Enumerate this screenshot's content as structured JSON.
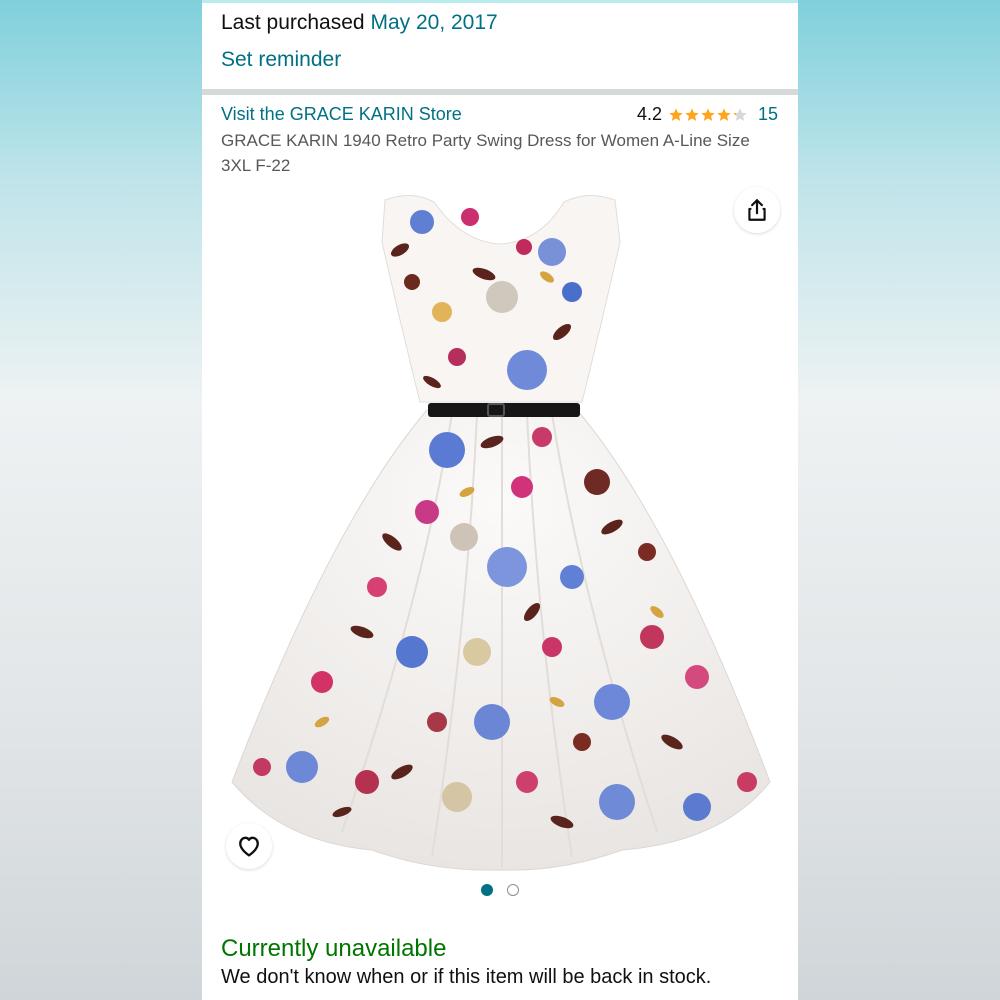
{
  "purchase": {
    "label": "Last purchased",
    "date": "May 20, 2017",
    "reminder_label": "Set reminder"
  },
  "product": {
    "store_link": "Visit the GRACE KARIN Store",
    "rating_value": "4.2",
    "rating_stars": 4.2,
    "rating_count": "15",
    "title": "GRACE KARIN 1940 Retro Party Swing Dress for Women A-Line Size 3XL F-22"
  },
  "gallery": {
    "image_count": 2,
    "active_index": 0
  },
  "availability": {
    "status": "Currently unavailable",
    "message": "We don't know when or if this item will be back in stock."
  },
  "icons": {
    "share": "share-icon",
    "wishlist": "heart-icon",
    "star": "star-icon"
  },
  "colors": {
    "link": "#007185",
    "star": "#ffa41c",
    "unavailable": "#007600"
  }
}
